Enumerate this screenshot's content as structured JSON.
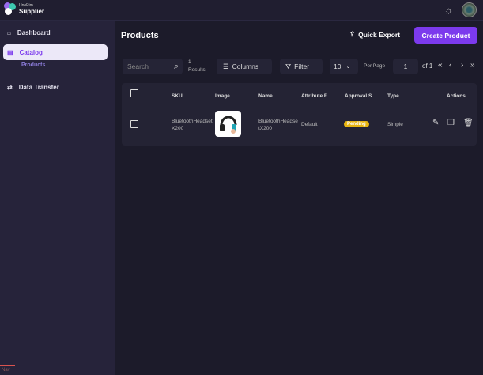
{
  "brand": {
    "small": "UnoPim",
    "name": "Supplier"
  },
  "sidebar": {
    "items": [
      {
        "label": "Dashboard"
      },
      {
        "label": "Catalog",
        "sub": "Products"
      },
      {
        "label": "Data Transfer"
      }
    ],
    "footer": "Nav"
  },
  "header": {
    "title": "Products",
    "quick_export": "Quick Export",
    "create": "Create Product"
  },
  "toolbar": {
    "search_placeholder": "Search",
    "results_count": "1",
    "results_label": "Results",
    "columns": "Columns",
    "filter": "Filter",
    "per_page_value": "10",
    "per_page_label": "Per Page",
    "page": "1",
    "of_pages": "of 1"
  },
  "table": {
    "headers": [
      "SKU",
      "Image",
      "Name",
      "Attribute F...",
      "Approval S...",
      "Type",
      "Actions"
    ],
    "rows": [
      {
        "sku": "BluetoothHeadsetX200",
        "name": "BluetoothHeadsetX200",
        "attribute_family": "Default",
        "approval": "Pending",
        "type": "Simple"
      }
    ]
  },
  "colors": {
    "accent": "#7c3aed",
    "pending": "#e8b511"
  }
}
